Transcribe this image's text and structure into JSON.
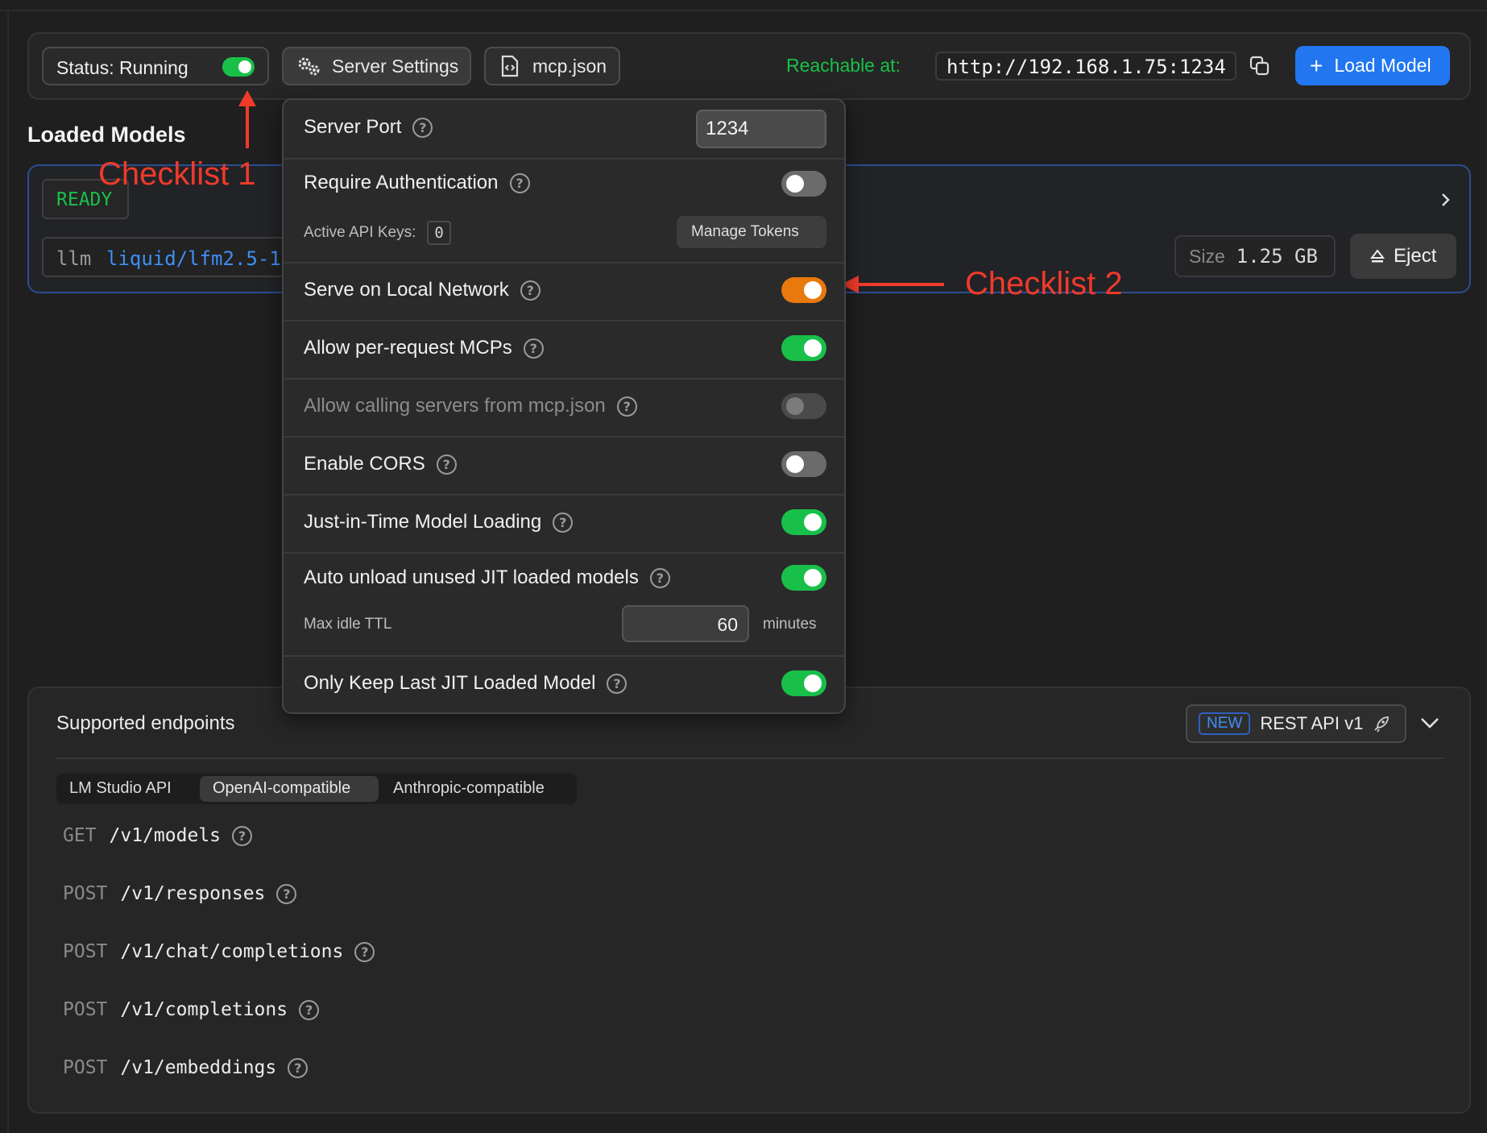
{
  "toolbar": {
    "status_label": "Status: Running",
    "server_settings_label": "Server Settings",
    "mcp_label": "mcp.json",
    "reachable_label": "Reachable at:",
    "url": "http://192.168.1.75:1234",
    "load_model_label": "Load Model"
  },
  "loaded_models": {
    "title": "Loaded Models",
    "badge": "READY",
    "model_type": "llm",
    "model_id": "liquid/lfm2.5-1",
    "size_label": "Size",
    "size_value": "1.25 GB",
    "eject_label": "Eject"
  },
  "annotations": {
    "checklist1": "Checklist 1",
    "checklist2": "Checklist 2"
  },
  "settings": {
    "server_port_label": "Server Port",
    "server_port_value": "1234",
    "require_auth_label": "Require Authentication",
    "require_auth": false,
    "active_keys_label": "Active API Keys:",
    "active_keys_value": "0",
    "manage_tokens_label": "Manage Tokens",
    "serve_local_label": "Serve on Local Network",
    "serve_local": true,
    "per_request_mcp_label": "Allow per-request MCPs",
    "per_request_mcp": true,
    "calling_servers_label": "Allow calling servers from mcp.json",
    "calling_servers": false,
    "cors_label": "Enable CORS",
    "cors": false,
    "jit_label": "Just-in-Time Model Loading",
    "jit": true,
    "auto_unload_label": "Auto unload unused JIT loaded models",
    "auto_unload": true,
    "max_idle_label": "Max idle TTL",
    "max_idle_value": "60",
    "max_idle_unit": "minutes",
    "keep_last_label": "Only Keep Last JIT Loaded Model",
    "keep_last": true
  },
  "endpoints": {
    "title": "Supported endpoints",
    "new_badge": "NEW",
    "rest_label": "REST API v1",
    "tabs": [
      "LM Studio API",
      "OpenAI-compatible",
      "Anthropic-compatible"
    ],
    "active_tab": "OpenAI-compatible",
    "list": [
      {
        "method": "GET",
        "path": "/v1/models"
      },
      {
        "method": "POST",
        "path": "/v1/responses"
      },
      {
        "method": "POST",
        "path": "/v1/chat/completions"
      },
      {
        "method": "POST",
        "path": "/v1/completions"
      },
      {
        "method": "POST",
        "path": "/v1/embeddings"
      }
    ]
  },
  "colors": {
    "accent_blue": "#2277f0",
    "green": "#18c04a",
    "orange": "#e8790c",
    "annotation_red": "#f03a2a"
  }
}
